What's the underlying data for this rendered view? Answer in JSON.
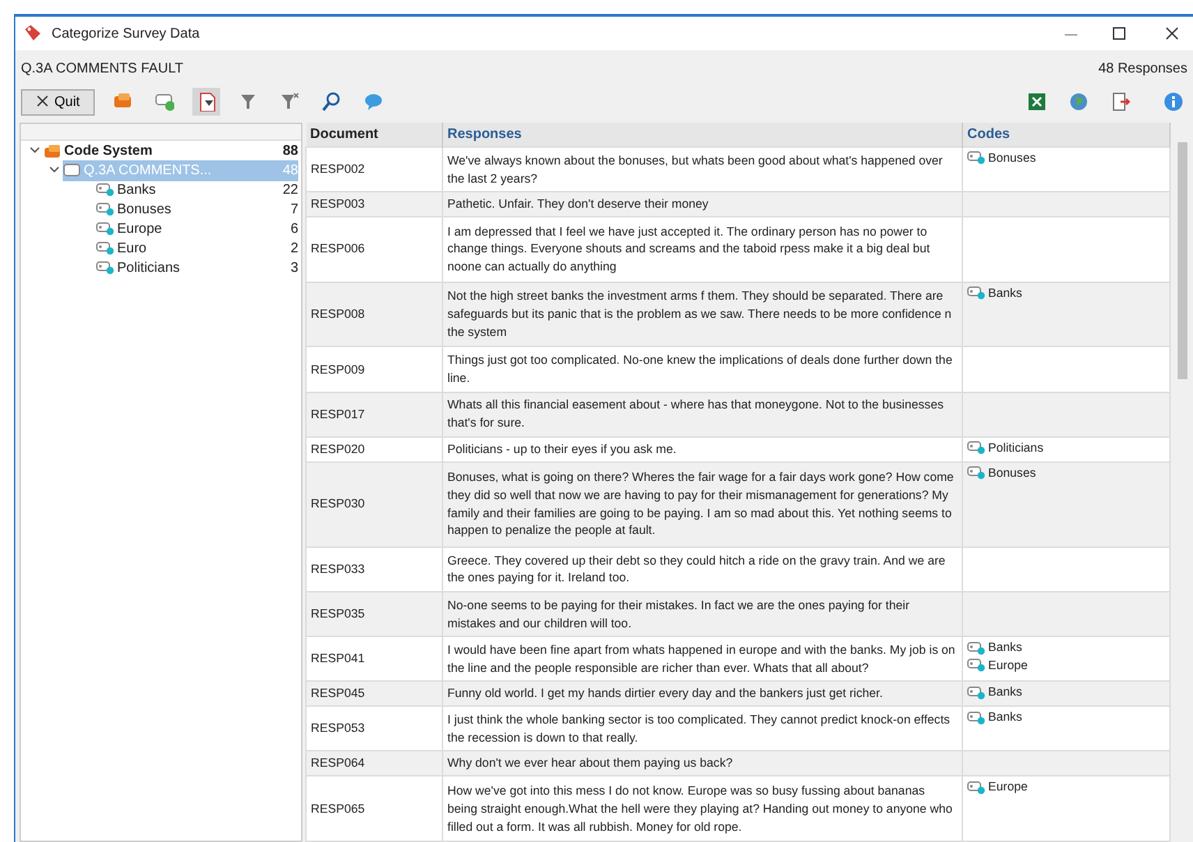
{
  "window": {
    "title": "Categorize Survey Data"
  },
  "header": {
    "variable": "Q.3A COMMENTS FAULT",
    "count": "48 Responses"
  },
  "toolbar": {
    "quit": "Quit",
    "filter_active": true
  },
  "tree": {
    "items": [
      {
        "label": "Code System",
        "count": "88",
        "expanded": true,
        "selected": false,
        "kind": "root",
        "children": [
          {
            "label": "Q.3A COMMENTS...",
            "count": "48",
            "expanded": true,
            "selected": true,
            "kind": "variable",
            "children": [
              {
                "label": "Banks",
                "count": "22",
                "selected": false,
                "kind": "code"
              },
              {
                "label": "Bonuses",
                "count": "7",
                "selected": false,
                "kind": "code"
              },
              {
                "label": "Europe",
                "count": "6",
                "selected": false,
                "kind": "code"
              },
              {
                "label": "Euro",
                "count": "2",
                "selected": false,
                "kind": "code"
              },
              {
                "label": "Politicians",
                "count": "3",
                "selected": false,
                "kind": "code"
              }
            ]
          }
        ]
      }
    ]
  },
  "table": {
    "columns": [
      "Document",
      "Responses",
      "Codes"
    ],
    "rows": [
      {
        "document": "RESP002",
        "response": "We've always known about the bonuses, but whats been good about what's happened over the last 2 years?",
        "codes": [
          "Bonuses"
        ]
      },
      {
        "document": "RESP003",
        "response": "Pathetic. Unfair. They don't deserve their money",
        "codes": []
      },
      {
        "document": "RESP006",
        "response": "I am depressed that I feel we have just accepted it. The ordinary person has no power to change things. Everyone shouts and screams and the taboid rpess make it a big deal but noone can actually do anything",
        "codes": []
      },
      {
        "document": "RESP008",
        "response": "Not the high street banks the investment arms f them. They should be separated. There are safeguards but its panic that is the problem as we saw. There needs to be more confidence n the system",
        "codes": [
          "Banks"
        ]
      },
      {
        "document": "RESP009",
        "response": "Things just got too complicated. No-one knew the implications of deals done further down the line.",
        "codes": []
      },
      {
        "document": "RESP017",
        "response": "Whats all this  financial easement about - where has that moneygone. Not to the businesses that's for sure.",
        "codes": []
      },
      {
        "document": "RESP020",
        "response": "Politicians - up to their eyes if you ask me.",
        "codes": [
          "Politicians"
        ]
      },
      {
        "document": "RESP030",
        "response": "Bonuses, what is going on there? Wheres the fair wage for  a fair days work gone? How come they did so well that now we are having to pay for their mismanagement for generations? My family and their families are going to be paying. I am so mad about this. Yet nothing seems to happen to penalize the people at fault.",
        "codes": [
          "Bonuses"
        ]
      },
      {
        "document": "RESP033",
        "response": "Greece. They covered up their debt so they could hitch a ride on the gravy train. And we are the ones paying for it. Ireland too.",
        "codes": []
      },
      {
        "document": "RESP035",
        "response": "No-one seems to be paying for their mistakes. In fact we are the ones paying for their mistakes and our children will too.",
        "codes": []
      },
      {
        "document": "RESP041",
        "response": "I would have been fine apart from whats happened in europe and with the banks. My job is on the line and the people responsible are richer than ever. Whats that all about?",
        "codes": [
          "Banks",
          "Europe"
        ]
      },
      {
        "document": "RESP045",
        "response": "Funny old world. I get my hands dirtier every day and the bankers just get richer.",
        "codes": [
          "Banks"
        ]
      },
      {
        "document": "RESP053",
        "response": "I just think the whole banking sector is too complicated. They cannot predict knock-on effects the recession is down to that really.",
        "codes": [
          "Banks"
        ]
      },
      {
        "document": "RESP064",
        "response": "Why don't we ever hear about them paying us back?",
        "codes": []
      },
      {
        "document": "RESP065",
        "response": "How we've got into this mess I do not know. Europe was so busy fussing about bananas being straight enough.What the hell were they playing at? Handing out money to anyone who filled out a form. It was all rubbish.  Money for old rope.",
        "codes": [
          "Europe"
        ]
      }
    ]
  }
}
